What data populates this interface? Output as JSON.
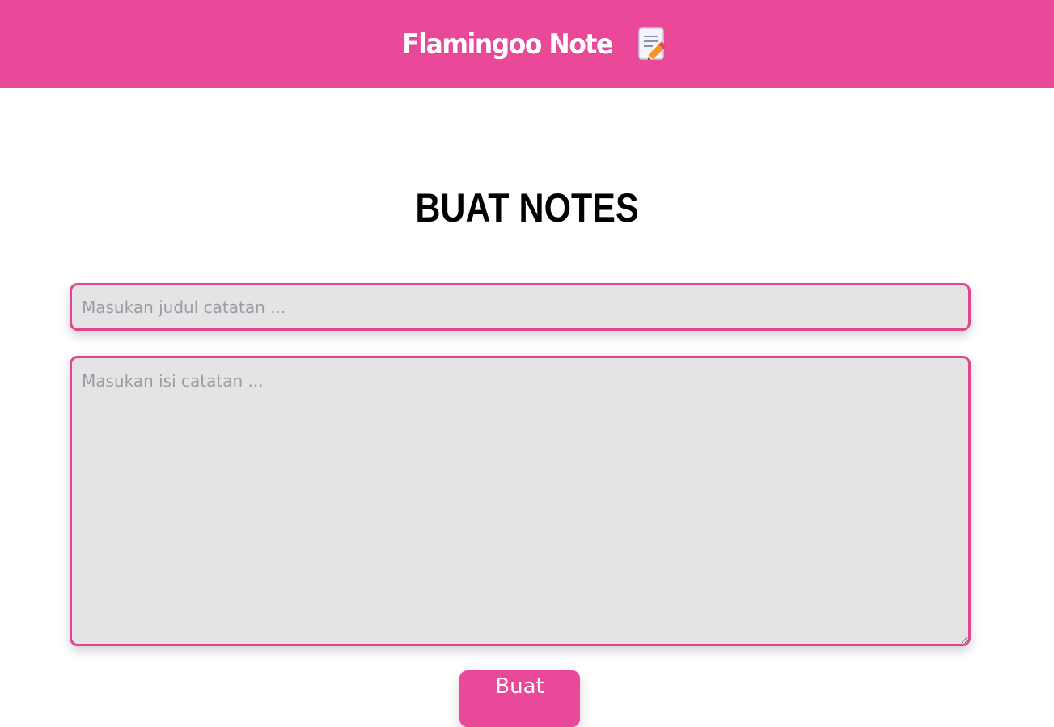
{
  "navbar": {
    "title": "Flamingoo Note",
    "icon": "memo-pencil-icon",
    "background_color": "#ea4899"
  },
  "main": {
    "heading": "BUAT NOTES",
    "title_input": {
      "value": "",
      "placeholder": "Masukan judul catatan ..."
    },
    "body_textarea": {
      "value": "",
      "placeholder": "Masukan isi catatan ..."
    },
    "submit_label": "Buat",
    "accent_color": "#ea4899",
    "field_border_color": "#e04590",
    "field_background": "#e4e4e4"
  }
}
